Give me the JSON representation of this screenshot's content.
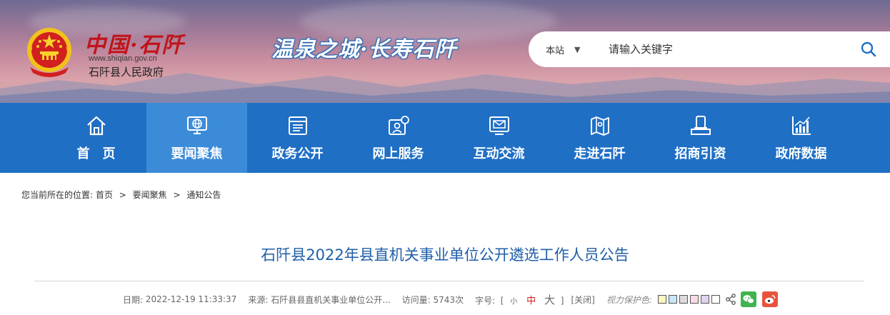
{
  "header": {
    "site_logo": "中国·石阡",
    "site_url": "www.shiqian.gov.cn",
    "site_name": "石阡县人民政府",
    "slogan": "温泉之城·长寿石阡",
    "search": {
      "scope": "本站",
      "placeholder": "请输入关键字"
    }
  },
  "nav": {
    "items": [
      {
        "label": "首　页",
        "icon": "home-icon"
      },
      {
        "label": "要闻聚焦",
        "icon": "globe-monitor-icon",
        "active": true
      },
      {
        "label": "政务公开",
        "icon": "document-list-icon"
      },
      {
        "label": "网上服务",
        "icon": "user-service-icon"
      },
      {
        "label": "互动交流",
        "icon": "mail-screen-icon"
      },
      {
        "label": "走进石阡",
        "icon": "map-icon"
      },
      {
        "label": "招商引资",
        "icon": "briefcase-icon"
      },
      {
        "label": "政府数据",
        "icon": "bar-chart-icon"
      }
    ]
  },
  "breadcrumb": {
    "prefix": "您当前所在的位置:",
    "items": [
      "首页",
      "要闻聚焦",
      "通知公告"
    ],
    "separator": ">"
  },
  "article": {
    "title": "石阡县2022年县直机关事业单位公开遴选工作人员公告",
    "date_label": "日期:",
    "date": "2022-12-19 11:33:37",
    "source_label": "来源:",
    "source": "石阡县县直机关事业单位公开...",
    "views_label": "访问量:",
    "views": "5743次",
    "fontsize_label": "字号:",
    "bracket_open": "[",
    "bracket_close": "]",
    "size_small": "小",
    "size_medium": "中",
    "size_large": "大",
    "close": "[关闭]",
    "vision_label": "视力保护色:",
    "swatches": [
      "#fbf6c1",
      "#c7e7f9",
      "#dcdcdc",
      "#f8dbe8",
      "#e2d3f1",
      "#ffffff"
    ]
  },
  "colors": {
    "nav_bg": "#1f6fc5",
    "nav_active": "#3c8bd9",
    "title_blue": "#1f5fa8",
    "logo_red": "#c0141a",
    "wechat": "#3fb34f",
    "weibo": "#e8533d"
  }
}
